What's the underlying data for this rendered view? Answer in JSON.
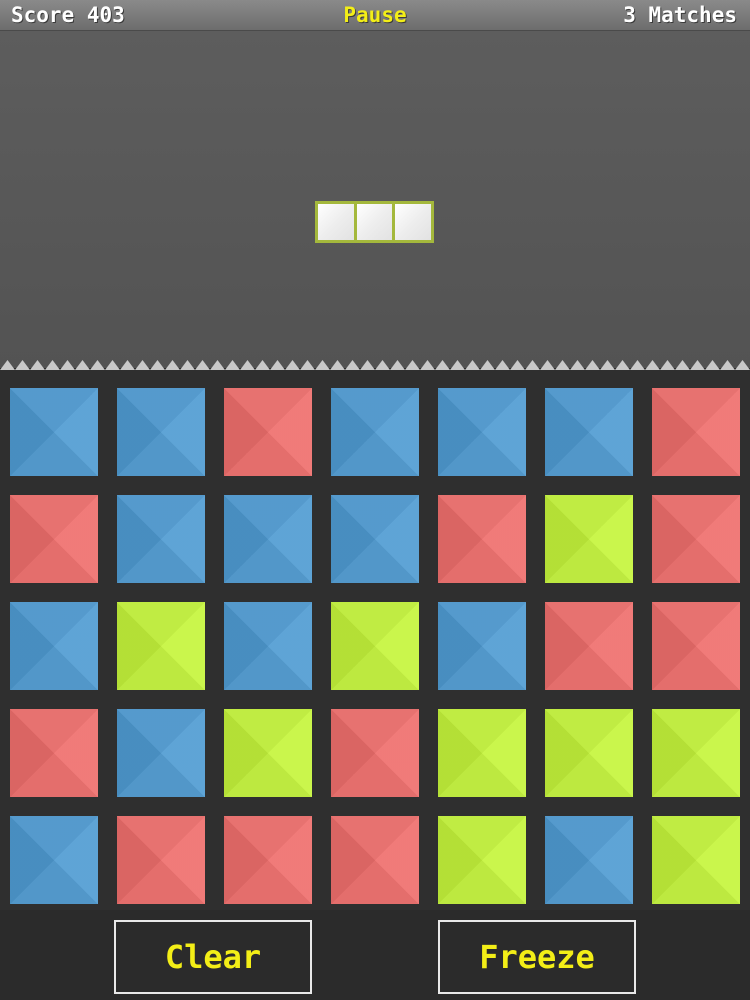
{
  "header": {
    "score": "Score 403",
    "pause": "Pause",
    "matches": "3 Matches"
  },
  "falling_piece": {
    "cells": 3,
    "color": "#f4f4f4",
    "border_color": "#a4b83c"
  },
  "colors": {
    "blue": "#4f9bd2",
    "red": "#ef6e6c",
    "green": "#c5f53b"
  },
  "board": {
    "rows": 5,
    "cols": 7,
    "tiles": [
      [
        "blue",
        "blue",
        "red",
        "blue",
        "blue",
        "blue",
        "red"
      ],
      [
        "red",
        "blue",
        "blue",
        "blue",
        "red",
        "green",
        "red"
      ],
      [
        "blue",
        "green",
        "blue",
        "green",
        "blue",
        "red",
        "red"
      ],
      [
        "red",
        "blue",
        "green",
        "red",
        "green",
        "green",
        "green"
      ],
      [
        "blue",
        "red",
        "red",
        "red",
        "green",
        "blue",
        "green"
      ]
    ]
  },
  "buttons": {
    "clear": "Clear",
    "freeze": "Freeze"
  }
}
